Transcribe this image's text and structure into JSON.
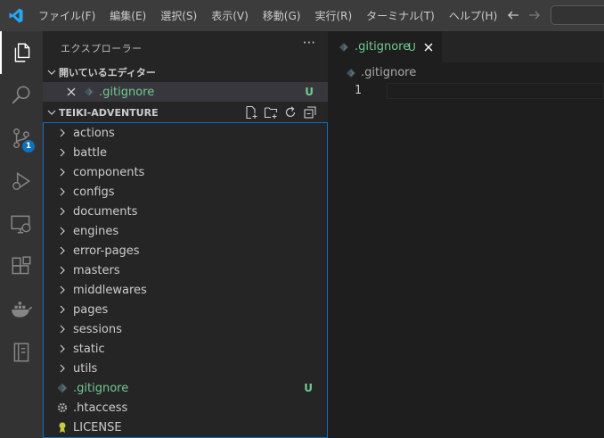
{
  "menu": [
    "ファイル(F)",
    "編集(E)",
    "選択(S)",
    "表示(V)",
    "移動(G)",
    "実行(R)",
    "ターミナル(T)",
    "ヘルプ(H)"
  ],
  "activity": {
    "scm_badge": "1"
  },
  "explorer": {
    "title": "エクスプローラー",
    "more": "···",
    "open_editors": {
      "label": "開いているエディター",
      "file": ".gitignore",
      "status": "U"
    },
    "project": {
      "label": "TEIKI-ADVENTURE",
      "folders": [
        "actions",
        "battle",
        "components",
        "configs",
        "documents",
        "engines",
        "error-pages",
        "masters",
        "middlewares",
        "pages",
        "sessions",
        "static",
        "utils"
      ],
      "files": [
        {
          "name": ".gitignore",
          "status": "U",
          "icon": "diamond-icon",
          "color": "#73c991"
        },
        {
          "name": ".htaccess",
          "status": "",
          "icon": "gear-icon",
          "color": "#cccccc"
        },
        {
          "name": "LICENSE",
          "status": "",
          "icon": "license-icon",
          "color": "#cccccc"
        }
      ]
    }
  },
  "editor": {
    "tab": {
      "label": ".gitignore",
      "status": "U"
    },
    "breadcrumb": ".gitignore",
    "line_number": "1"
  },
  "colors": {
    "accent": "#0e70c0",
    "untracked": "#73c991",
    "tab_text": "#73c991"
  }
}
